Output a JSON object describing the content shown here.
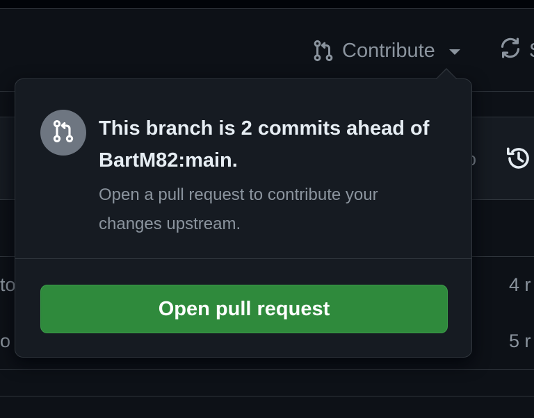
{
  "toolbar": {
    "contribute_label": "Contribute",
    "sync_label_partial": "S"
  },
  "background": {
    "panel_text_partial": "o",
    "row1_left_partial": "to",
    "row1_right_partial": "4 r",
    "row2_left_partial": "o r",
    "row2_right_partial": "5 r"
  },
  "popover": {
    "title": "This branch is 2 commits ahead of BartM82:main.",
    "description": "Open a pull request to contribute your changes upstream.",
    "button_label": "Open pull request"
  },
  "colors": {
    "background": "#0d1117",
    "popover_bg": "#161b22",
    "border": "#30363d",
    "primary_text": "#e6edf3",
    "muted_text": "#8b949e",
    "button_green": "#2f8a3c",
    "icon_circle": "#6e7681"
  },
  "icons": {
    "contribute": "git-pull-request-icon",
    "sync": "sync-icon",
    "history": "history-icon",
    "popover": "git-pull-request-icon"
  }
}
